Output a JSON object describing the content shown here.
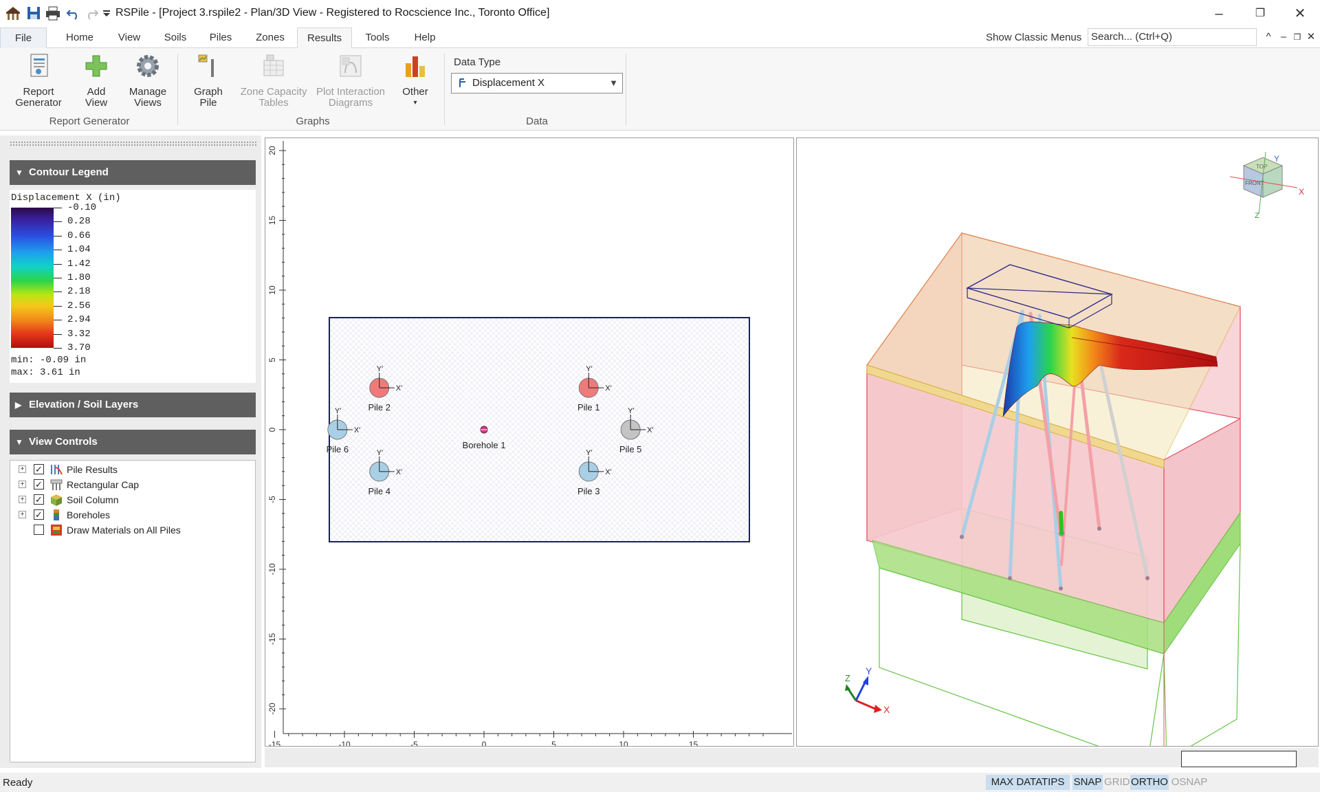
{
  "window": {
    "title": "RSPile - [Project 3.rspile2 - Plan/3D View - Registered to Rocscience Inc., Toronto Office]",
    "minimize": "–",
    "restore": "❐",
    "close": "✕"
  },
  "menu": {
    "tabs": [
      "File",
      "Home",
      "View",
      "Soils",
      "Piles",
      "Zones",
      "Results",
      "Tools",
      "Help"
    ],
    "active_tab": "Results",
    "show_classic_menus": "Show Classic Menus",
    "search_placeholder": "Search... (Ctrl+Q)"
  },
  "ribbon": {
    "report_generator": {
      "line1": "Report",
      "line2": "Generator"
    },
    "add_view": {
      "line1": "Add",
      "line2": "View"
    },
    "manage_views": {
      "line1": "Manage",
      "line2": "Views"
    },
    "graph_pile": {
      "line1": "Graph",
      "line2": "Pile"
    },
    "zone_capacity": {
      "line1": "Zone Capacity",
      "line2": "Tables"
    },
    "plot_interaction": {
      "line1": "Plot Interaction",
      "line2": "Diagrams"
    },
    "other": {
      "line1": "Other",
      "line2": "▾"
    },
    "groups": {
      "report": "Report Generator",
      "graphs": "Graphs",
      "data": "Data"
    },
    "data_type_label": "Data Type",
    "data_type_value": "Displacement X"
  },
  "left_panel": {
    "contour_legend": {
      "header": "Contour Legend",
      "title": "Displacement X (in)",
      "labels": [
        "-0.10",
        "0.28",
        "0.66",
        "1.04",
        "1.42",
        "1.80",
        "2.18",
        "2.56",
        "2.94",
        "3.32",
        "3.70"
      ],
      "min": "min: -0.09 in",
      "max": "max: 3.61 in"
    },
    "elevation_header": "Elevation / Soil Layers",
    "view_controls": {
      "header": "View Controls",
      "items": [
        {
          "label": "Pile Results",
          "checked": true,
          "expandable": true
        },
        {
          "label": "Rectangular Cap",
          "checked": true,
          "expandable": true
        },
        {
          "label": "Soil Column",
          "checked": true,
          "expandable": true
        },
        {
          "label": "Boreholes",
          "checked": true,
          "expandable": true
        },
        {
          "label": "Draw Materials on All Piles",
          "checked": false,
          "expandable": false
        }
      ]
    }
  },
  "plan_view": {
    "x_ticks": [
      "-15",
      "-10",
      "-5",
      "0",
      "5",
      "10",
      "15"
    ],
    "y_ticks": [
      "20",
      "15",
      "10",
      "5",
      "0",
      "-5",
      "-10",
      "-15",
      "-20"
    ],
    "piles": [
      {
        "name": "Pile 1",
        "x": 7.5,
        "y": 3,
        "color": "#f07a7a"
      },
      {
        "name": "Pile 2",
        "x": -7.5,
        "y": 3,
        "color": "#f07a7a"
      },
      {
        "name": "Pile 3",
        "x": 7.5,
        "y": -3,
        "color": "#a9cfe6"
      },
      {
        "name": "Pile 4",
        "x": -7.5,
        "y": -3,
        "color": "#a9cfe6"
      },
      {
        "name": "Pile 5",
        "x": 10.5,
        "y": 0,
        "color": "#c4c4c4"
      },
      {
        "name": "Pile 6",
        "x": -10.5,
        "y": 0,
        "color": "#a9cfe6"
      }
    ],
    "borehole": {
      "name": "Borehole 1",
      "x": 0,
      "y": 0
    },
    "axis_labels": {
      "x": "X'",
      "y": "Y'"
    }
  },
  "view_3d": {
    "axes": {
      "x": "X",
      "y": "Y",
      "z": "Z"
    },
    "nav_cube": {
      "top": "TOP",
      "front": "FRONT"
    }
  },
  "status_bar": {
    "text": "Ready",
    "items": [
      {
        "label": "MAX DATATIPS",
        "on": true
      },
      {
        "label": "SNAP",
        "on": true
      },
      {
        "label": "GRID",
        "on": false
      },
      {
        "label": "ORTHO",
        "on": true
      },
      {
        "label": "OSNAP",
        "on": false
      }
    ]
  },
  "colors": {
    "legend_header": "#5f5f5f",
    "plan_boundary": "#1a1a7a",
    "soil_pink": "#f2c4c8",
    "soil_green": "#9fdc7a",
    "status_on": "#c9def0"
  }
}
